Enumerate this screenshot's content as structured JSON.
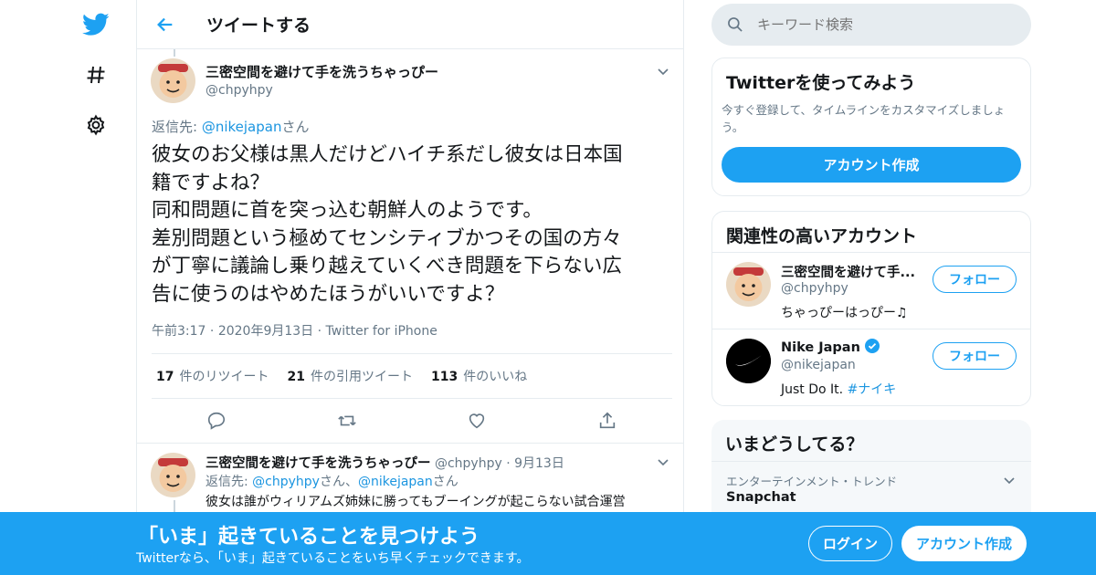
{
  "colors": {
    "accent": "#1da1f2",
    "border": "#e6ecf0",
    "muted": "#657786",
    "banner": "#1da1f2"
  },
  "rail": {
    "icons": [
      "twitter-bird-icon",
      "hashtag-icon",
      "gear-icon"
    ]
  },
  "header": {
    "title": "ツイートする"
  },
  "tweet": {
    "name": "三密空間を避けて手を洗うちゃっぴー",
    "handle": "@chpyhpy",
    "reply_prefix": "返信先: ",
    "reply_to": "@nikejapan",
    "reply_suffix": "さん",
    "text": "彼女のお父様は黒人だけどハイチ系だし彼女は日本国\n籍ですよね？\n同和問題に首を突っ込む朝鮮人のようです。\n差別問題という極めてセンシティブかつその国の方々\nが丁寧に議論し乗り越えていくべき問題を下らない広\n告に使うのはやめたほうがいいですよ？",
    "time": "午前3:17",
    "date": "2020年9月13日",
    "source": "Twitter for iPhone",
    "retweets": "17",
    "retweets_label": "件のリツイート",
    "quotes": "21",
    "quotes_label": "件の引用ツイート",
    "likes": "113",
    "likes_label": "件のいいね"
  },
  "reply": {
    "name": "三密空間を避けて手を洗うちゃっぴー",
    "handle": "@chpyhpy",
    "date": "9月13日",
    "reply_prefix": "返信先: ",
    "reply_to_1": "@chpyhpy",
    "reply_mid": "さん、",
    "reply_to_2": "@nikejapan",
    "reply_suffix": "さん",
    "text": "彼女は誰がウィリアムズ姉妹に勝ってもブーイングが起こらない試合運営"
  },
  "search": {
    "placeholder": "キーワード検索"
  },
  "signup_card": {
    "title": "Twitterを使ってみよう",
    "desc": "今すぐ登録して、タイムラインをカスタマイズしましょう。",
    "button": "アカウント作成"
  },
  "related": {
    "title": "関連性の高いアカウント",
    "accounts": [
      {
        "name": "三密空間を避けて手...",
        "handle": "@chpyhpy",
        "bio": "ちゃっぴーはっぴー♫",
        "follow": "フォロー"
      },
      {
        "name": "Nike Japan",
        "handle": "@nikejapan",
        "bio": "Just Do It. ",
        "bio_tag": "#ナイキ",
        "follow": "フォロー",
        "verified": true
      }
    ]
  },
  "trends": {
    "title": "いまどうしてる？",
    "category": "エンターテインメント・トレンド",
    "item": "Snapchat"
  },
  "banner": {
    "title": "「いま」起きていることを見つけよう",
    "sub": "Twitterなら、「いま」起きていることをいち早くチェックできます。",
    "login": "ログイン",
    "signup": "アカウント作成"
  }
}
